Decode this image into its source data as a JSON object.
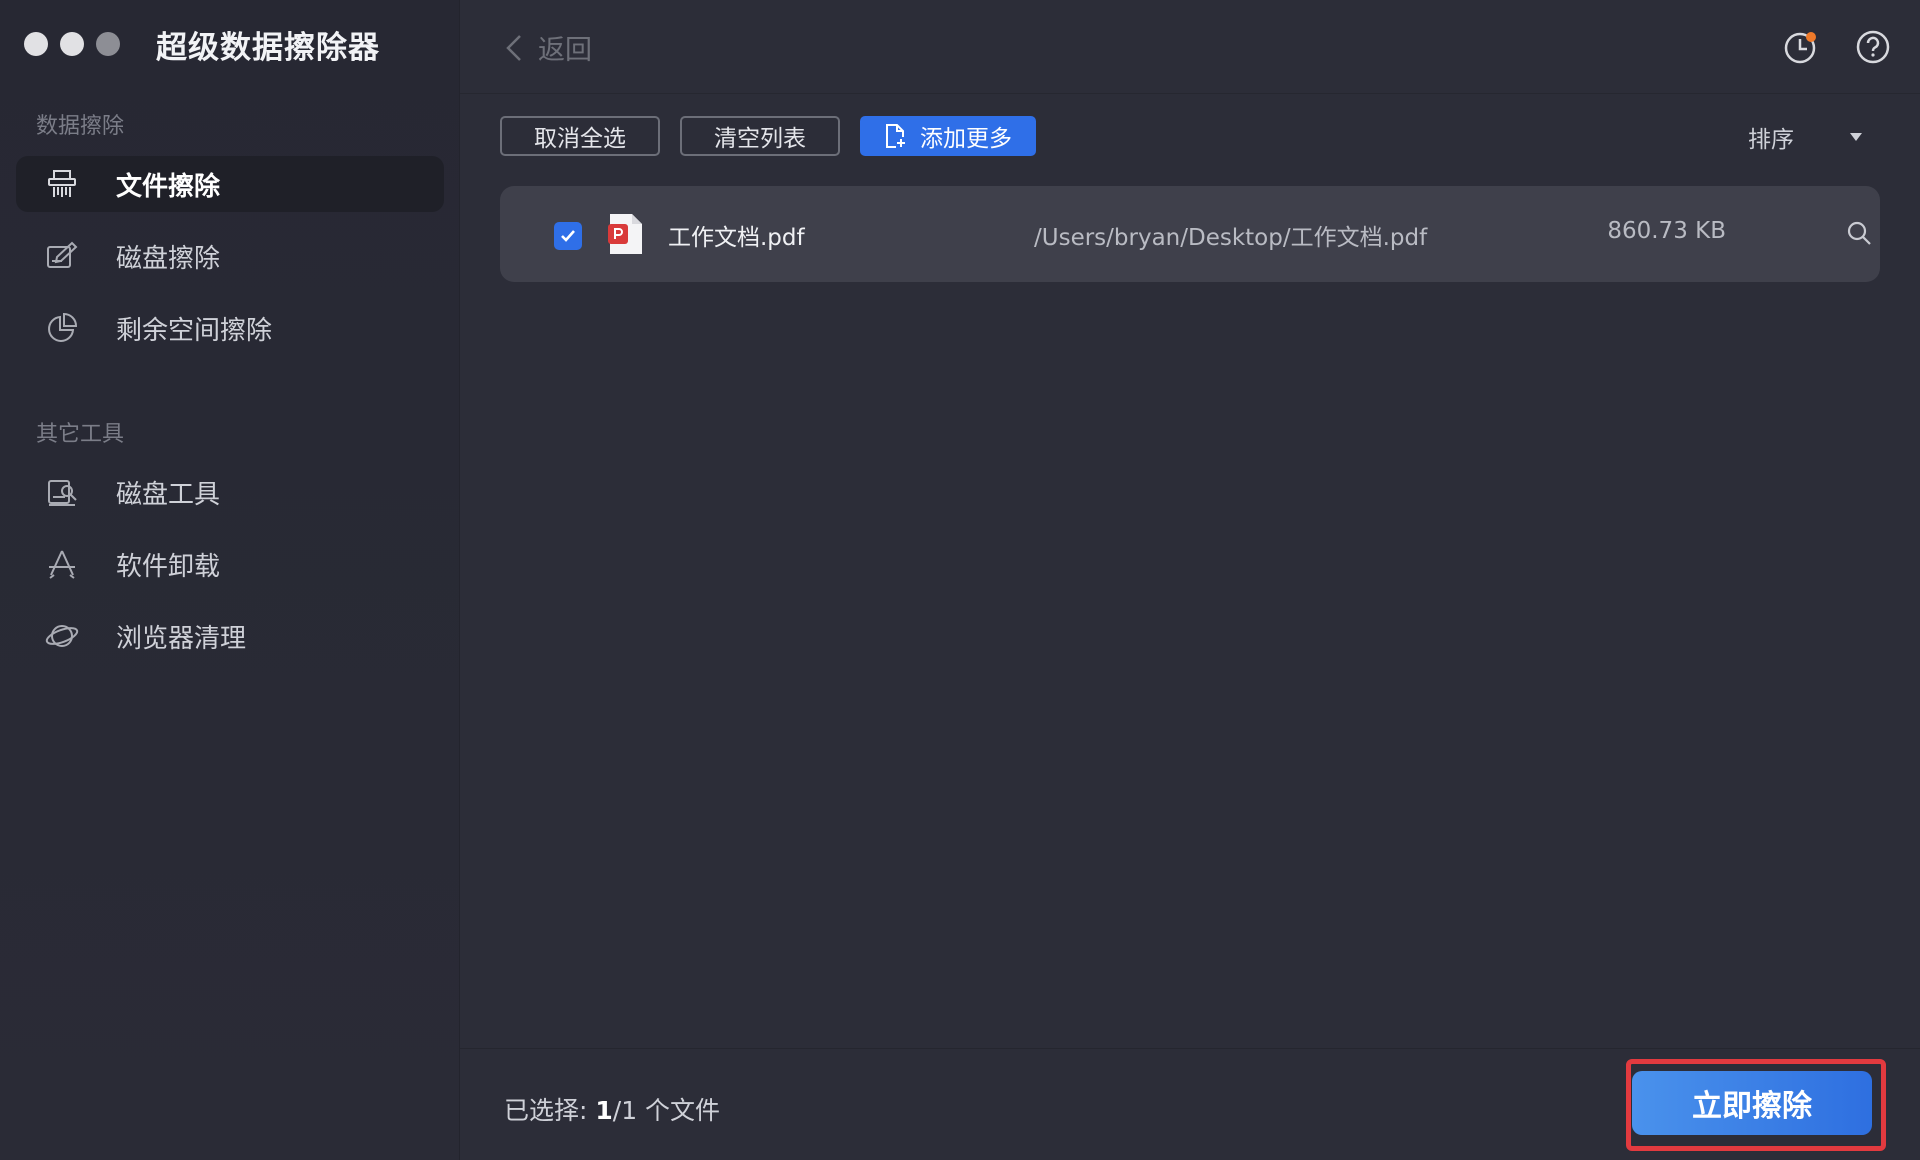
{
  "app": {
    "title": "超级数据擦除器"
  },
  "sidebar": {
    "section1": "数据擦除",
    "items1": [
      {
        "label": "文件擦除",
        "icon": "shredder-icon",
        "active": true
      },
      {
        "label": "磁盘擦除",
        "icon": "disk-erase-icon"
      },
      {
        "label": "剩余空间擦除",
        "icon": "pie-chart-icon"
      }
    ],
    "section2": "其它工具",
    "items2": [
      {
        "label": "磁盘工具",
        "icon": "disk-tool-icon"
      },
      {
        "label": "软件卸载",
        "icon": "app-store-icon"
      },
      {
        "label": "浏览器清理",
        "icon": "planet-icon"
      }
    ]
  },
  "topbar": {
    "back_label": "返回"
  },
  "toolbar": {
    "deselect_all": "取消全选",
    "clear_list": "清空列表",
    "add_more": "添加更多",
    "sort": "排序"
  },
  "files": [
    {
      "name": "工作文档.pdf",
      "path": "/Users/bryan/Desktop/工作文档.pdf",
      "size": "860.73 KB",
      "checked": true
    }
  ],
  "footer": {
    "status_prefix": "已选择: ",
    "status_count": "1",
    "status_suffix": "/1 个文件",
    "erase_button": "立即擦除"
  },
  "colors": {
    "accent": "#2f6fe8",
    "highlight": "#e23a3f",
    "notification": "#f07a2a"
  }
}
